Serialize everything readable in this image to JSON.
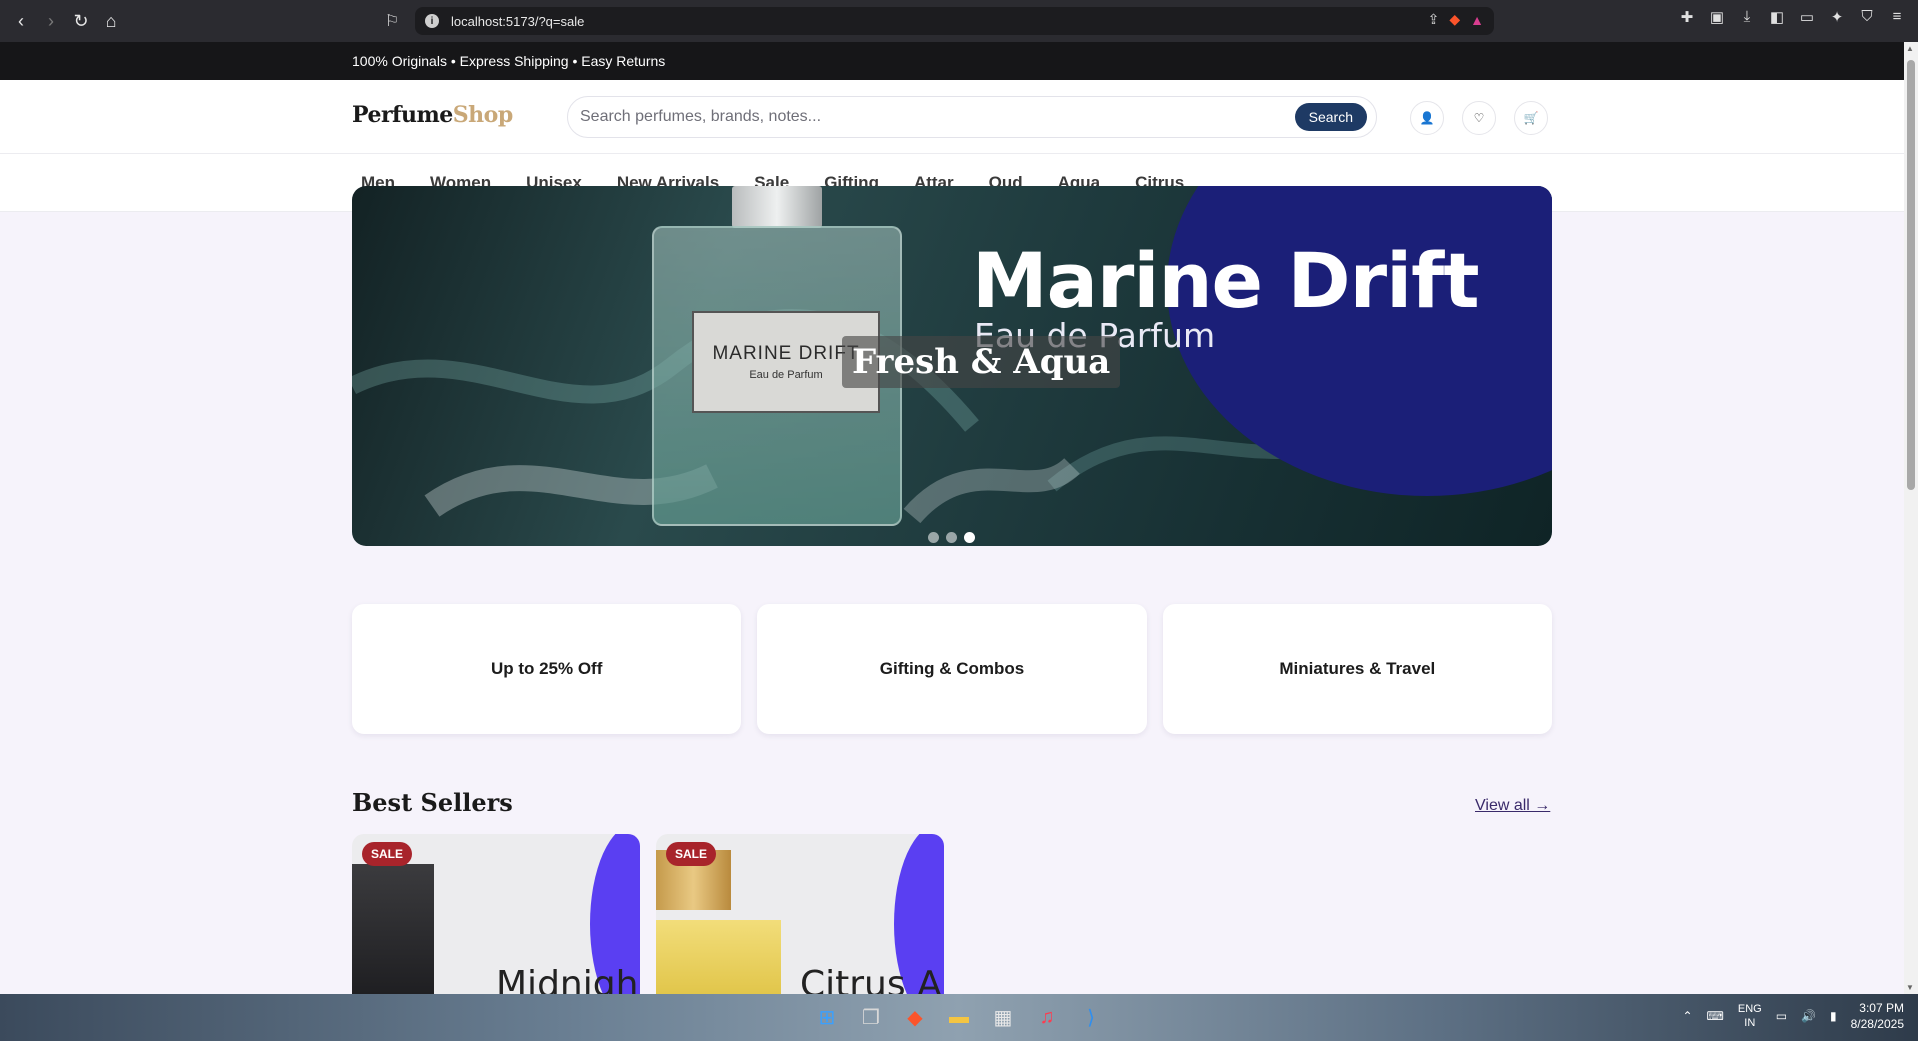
{
  "browser": {
    "url": "localhost:5173/?q=sale",
    "info_icon": "i"
  },
  "announce": {
    "text": "100% Originals • Express Shipping • Easy Returns"
  },
  "header": {
    "logo_main": "Perfume",
    "logo_accent": "Shop",
    "search_placeholder": "Search perfumes, brands, notes...",
    "search_button": "Search",
    "icons": [
      "user-icon",
      "heart-icon",
      "cart-icon"
    ]
  },
  "nav": {
    "items": [
      "Men",
      "Women",
      "Unisex",
      "New Arrivals",
      "Sale",
      "Gifting",
      "Attar",
      "Oud",
      "Aqua",
      "Citrus"
    ]
  },
  "hero": {
    "title": "Marine Drift",
    "subtitle": "Eau de Parfum",
    "bottle_label": "MARINE DRIFT",
    "bottle_sublabel": "Eau de Parfum",
    "caption": "Fresh & Aqua",
    "slides": 3,
    "active_slide": 3
  },
  "promos": [
    "Up to 25% Off",
    "Gifting & Combos",
    "Miniatures & Travel"
  ],
  "best_sellers": {
    "title": "Best Sellers",
    "view_all": "View all →",
    "products": [
      {
        "badge": "SALE",
        "name_visible": "Midnigh"
      },
      {
        "badge": "SALE",
        "name_visible": "Citrus A"
      }
    ]
  },
  "taskbar": {
    "lang_line1": "ENG",
    "lang_line2": "IN",
    "time": "3:07 PM",
    "date": "8/28/2025"
  },
  "colors": {
    "brand_accent": "#c9a878",
    "search_button": "#1e3a64",
    "sale_badge": "#a8242b",
    "page_bg": "#f6f3fb",
    "hero_disc": "#1b1f78"
  }
}
